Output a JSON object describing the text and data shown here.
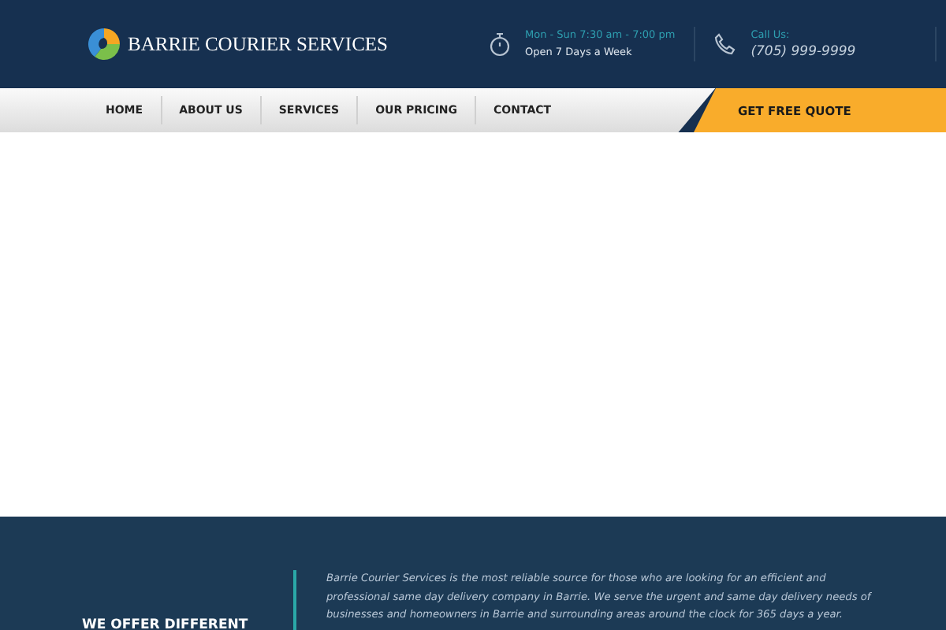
{
  "header": {
    "logo_text": "BARRIE COURIER SERVICES",
    "hours": {
      "label": "Mon - Sun 7:30 am - 7:00 pm",
      "value": "Open 7 Days a Week"
    },
    "phone": {
      "label": "Call Us:",
      "value": "(705) 999-9999"
    }
  },
  "nav": {
    "items": [
      {
        "label": "HOME"
      },
      {
        "label": "ABOUT US"
      },
      {
        "label": "SERVICES"
      },
      {
        "label": "OUR PRICING"
      },
      {
        "label": "CONTACT"
      }
    ],
    "cta": "GET FREE QUOTE"
  },
  "about": {
    "heading": "WE OFFER DIFFERENT",
    "text": "Barrie Courier Services is the most reliable source for those who are looking for an efficient and professional same day delivery company in Barrie. We serve the urgent and same day delivery needs of businesses and homeowners in Barrie and surrounding areas around the clock for 365 days a year."
  }
}
